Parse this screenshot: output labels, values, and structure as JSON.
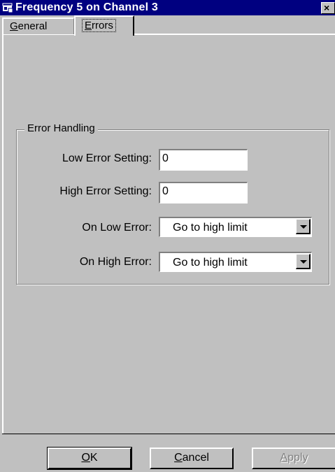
{
  "window": {
    "title": "Frequency 5 on Channel 3",
    "close_glyph": "×",
    "icon": "app-window-icon"
  },
  "tabs": [
    {
      "label": "General",
      "mnemonic": "G",
      "rest": "eneral",
      "active": false
    },
    {
      "label": "Errors",
      "mnemonic": "E",
      "rest": "rrors",
      "active": true
    }
  ],
  "group": {
    "title": "Error Handling",
    "low_error_setting": {
      "label": "Low Error Setting:",
      "value": "0"
    },
    "high_error_setting": {
      "label": "High Error Setting:",
      "value": "0"
    },
    "on_low_error": {
      "label": "On Low Error:",
      "value": "Go to high limit"
    },
    "on_high_error": {
      "label": "On High Error:",
      "value": "Go to high limit"
    }
  },
  "buttons": {
    "ok": {
      "mnemonic": "O",
      "rest": "K"
    },
    "cancel": {
      "mnemonic": "C",
      "rest": "ancel"
    },
    "apply": {
      "mnemonic": "A",
      "rest": "pply",
      "disabled": true
    }
  },
  "colors": {
    "titlebar": "#000080",
    "face": "#c0c0c0"
  }
}
